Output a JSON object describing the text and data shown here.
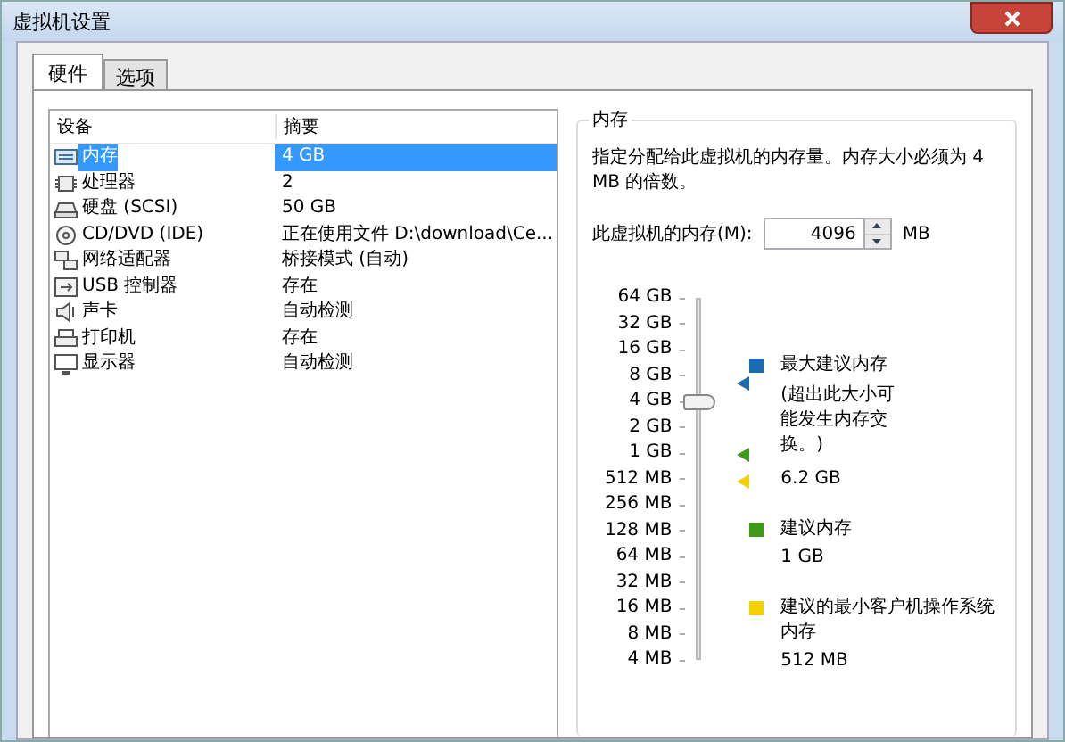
{
  "window": {
    "title": "虚拟机设置"
  },
  "tabs": [
    {
      "label": "硬件",
      "selected": true
    },
    {
      "label": "选项",
      "selected": false
    }
  ],
  "device_list": {
    "columns": [
      "设备",
      "摘要"
    ],
    "rows": [
      {
        "kind": "memory",
        "device": "内存",
        "summary": "4 GB",
        "selected": true
      },
      {
        "kind": "cpu",
        "device": "处理器",
        "summary": "2",
        "selected": false
      },
      {
        "kind": "disk",
        "device": "硬盘 (SCSI)",
        "summary": "50 GB",
        "selected": false
      },
      {
        "kind": "cd",
        "device": "CD/DVD (IDE)",
        "summary": "正在使用文件 D:\\download\\Ce...",
        "selected": false
      },
      {
        "kind": "network",
        "device": "网络适配器",
        "summary": "桥接模式 (自动)",
        "selected": false
      },
      {
        "kind": "usb",
        "device": "USB 控制器",
        "summary": "存在",
        "selected": false
      },
      {
        "kind": "sound",
        "device": "声卡",
        "summary": "自动检测",
        "selected": false
      },
      {
        "kind": "printer",
        "device": "打印机",
        "summary": "存在",
        "selected": false
      },
      {
        "kind": "display",
        "device": "显示器",
        "summary": "自动检测",
        "selected": false
      }
    ]
  },
  "memory_panel": {
    "title": "内存",
    "description": "指定分配给此虚拟机的内存量。内存大小必须为 4 MB 的倍数。",
    "memory_field": {
      "label": "此虚拟机的内存(M):",
      "value": "4096",
      "unit": "MB"
    },
    "slider": {
      "level": 0.714,
      "markers": [
        {
          "color": "#1a6ab4",
          "level": 0.77
        },
        {
          "color": "#3f9a1a",
          "level": 0.571
        },
        {
          "color": "#f5d000",
          "level": 0.5
        }
      ],
      "ticks": [
        "64 GB",
        "32 GB",
        "16 GB",
        "8 GB",
        "4 GB",
        "2 GB",
        "1 GB",
        "512 MB",
        "256 MB",
        "128 MB",
        "64 MB",
        "32 MB",
        "16 MB",
        "8 MB",
        "4 MB"
      ]
    },
    "legend": [
      {
        "title": "最大建议内存",
        "note": "(超出此大小可能发生内存交换。)",
        "value": "6.2 GB",
        "color": "#1a6ab4"
      },
      {
        "title": "建议内存",
        "value": "1 GB",
        "color": "#3f9a1a"
      },
      {
        "title": "建议的最小客户机操作系统内存",
        "value": "512 MB",
        "color": "#f5d000"
      }
    ]
  }
}
